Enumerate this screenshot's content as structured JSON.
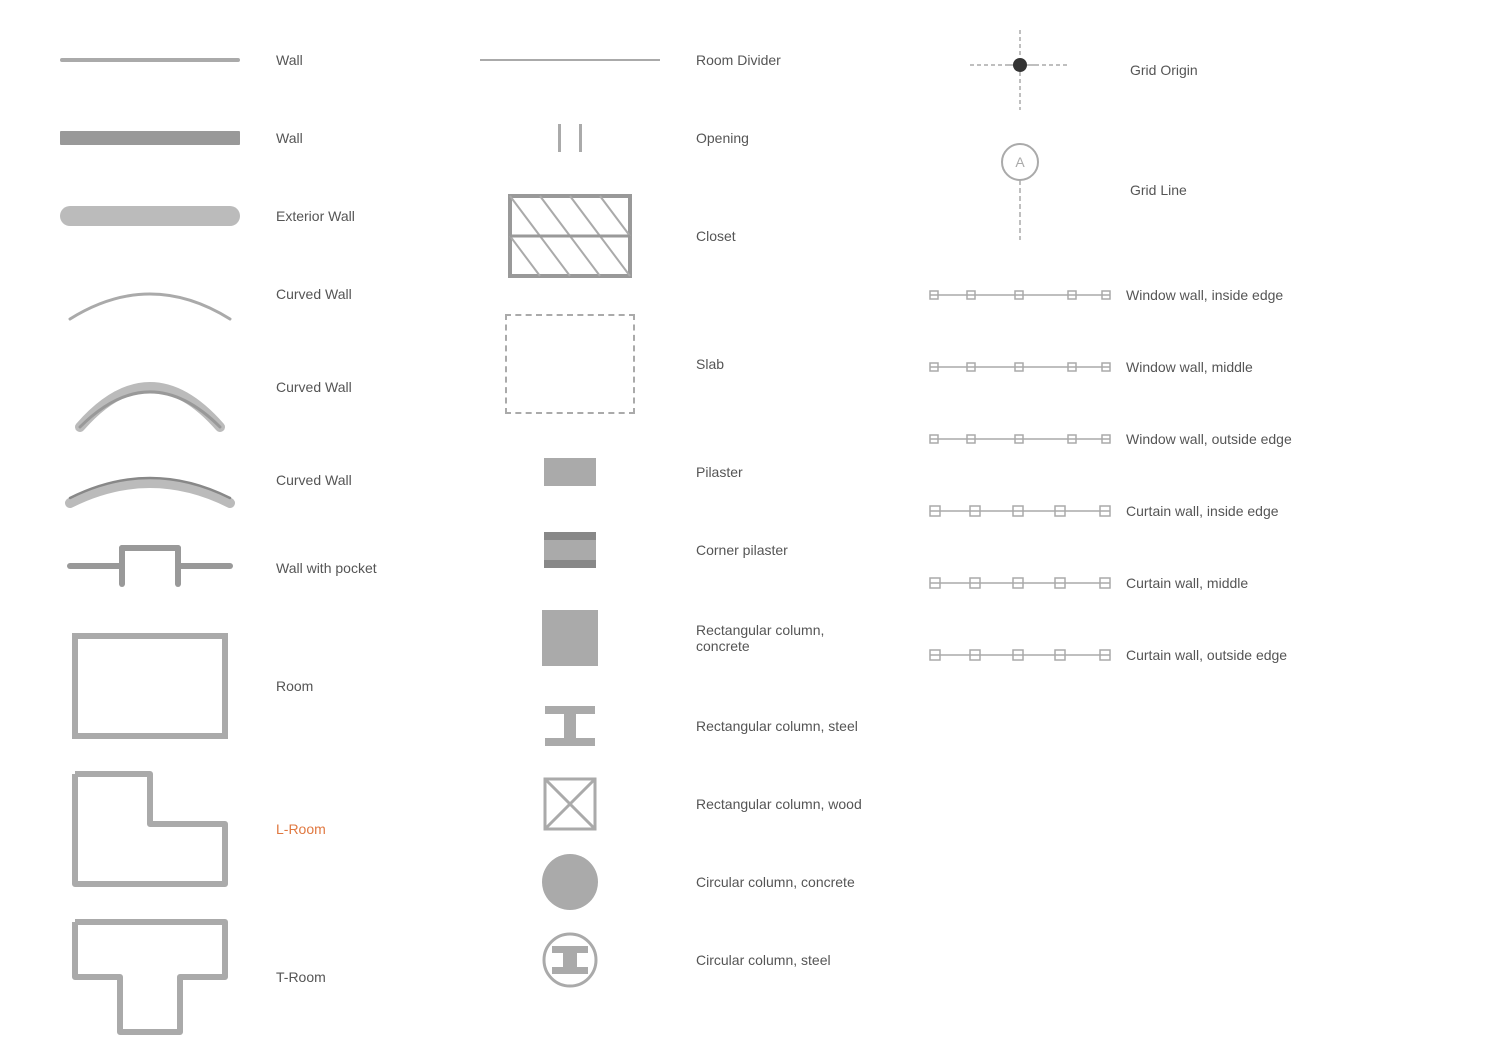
{
  "col1": {
    "items": [
      {
        "id": "wall-thin",
        "label": "Wall"
      },
      {
        "id": "wall-thick",
        "label": "Wall"
      },
      {
        "id": "exterior-wall",
        "label": "Exterior Wall"
      },
      {
        "id": "curved-wall-1",
        "label": "Curved Wall"
      },
      {
        "id": "curved-wall-2",
        "label": "Curved Wall"
      },
      {
        "id": "curved-wall-3",
        "label": "Curved Wall"
      },
      {
        "id": "wall-pocket",
        "label": "Wall with pocket"
      },
      {
        "id": "room",
        "label": "Room"
      },
      {
        "id": "l-room",
        "label": "L-Room"
      },
      {
        "id": "t-room",
        "label": "T-Room"
      }
    ]
  },
  "col2": {
    "items": [
      {
        "id": "room-divider",
        "label": "Room Divider"
      },
      {
        "id": "opening",
        "label": "Opening"
      },
      {
        "id": "closet",
        "label": "Closet"
      },
      {
        "id": "slab",
        "label": "Slab"
      },
      {
        "id": "pilaster",
        "label": "Pilaster"
      },
      {
        "id": "corner-pilaster",
        "label": "Corner pilaster"
      },
      {
        "id": "rect-col-concrete",
        "label": "Rectangular column, concrete"
      },
      {
        "id": "rect-col-steel",
        "label": "Rectangular column, steel"
      },
      {
        "id": "rect-col-wood",
        "label": "Rectangular column, wood"
      },
      {
        "id": "circ-col-concrete",
        "label": "Circular column, concrete"
      },
      {
        "id": "circ-col-steel",
        "label": "Circular column, steel"
      }
    ]
  },
  "col3": {
    "items": [
      {
        "id": "grid-origin",
        "label": "Grid Origin"
      },
      {
        "id": "grid-line",
        "label": "Grid Line"
      },
      {
        "id": "window-inside",
        "label": "Window wall, inside edge"
      },
      {
        "id": "window-middle",
        "label": "Window wall, middle"
      },
      {
        "id": "window-outside",
        "label": "Window wall, outside edge"
      },
      {
        "id": "curtain-inside",
        "label": "Curtain wall, inside edge"
      },
      {
        "id": "curtain-middle",
        "label": "Curtain wall, middle"
      },
      {
        "id": "curtain-outside",
        "label": "Curtain wall, outside edge"
      }
    ]
  }
}
